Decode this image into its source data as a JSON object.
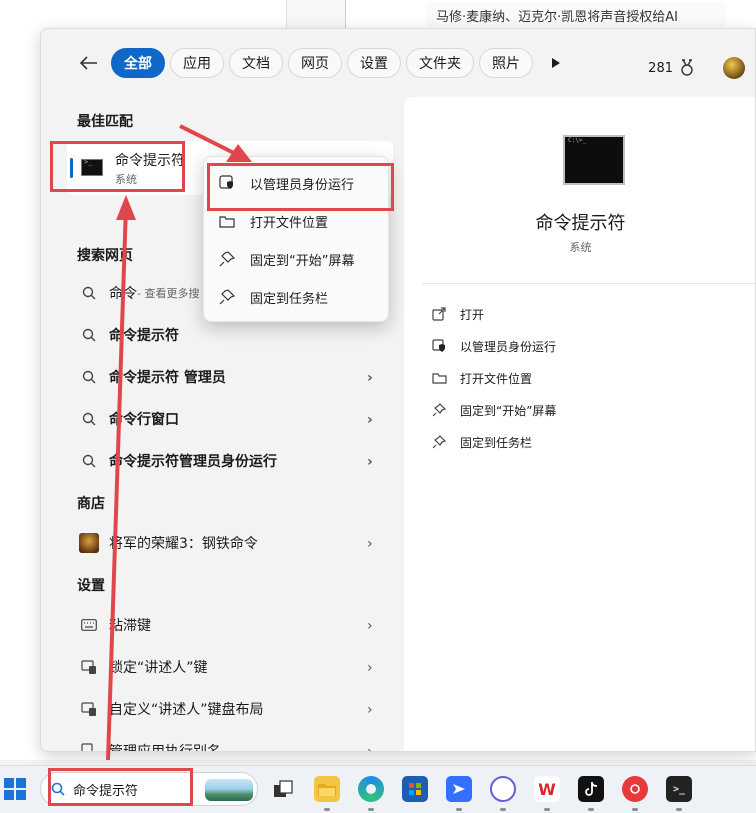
{
  "background": {
    "news_text": "马修·麦康纳、迈克尔·凯恩将声音授权给AI"
  },
  "tabs": {
    "items": [
      "全部",
      "应用",
      "文档",
      "网页",
      "设置",
      "文件夹",
      "照片"
    ],
    "active": "全部",
    "points": "281"
  },
  "left": {
    "best_match_header": "最佳匹配",
    "best_match": {
      "title": "命令提示符",
      "subtitle": "系统"
    },
    "web_header": "搜索网页",
    "web_results": [
      {
        "text": "命令",
        "suffix": " - 查看更多搜"
      },
      {
        "text": "命令提示符"
      },
      {
        "text": "命令提示符 管理员"
      },
      {
        "text": "命令行窗口"
      },
      {
        "text": "命令提示符管理员身份运行"
      }
    ],
    "store_header": "商店",
    "store_item": "将军的荣耀3：钢铁命令",
    "settings_header": "设置",
    "settings_items": [
      "粘滞键",
      "锁定“讲述人”键",
      "自定义“讲述人”键盘布局",
      "管理应用执行别名"
    ]
  },
  "context_menu": {
    "items": [
      "以管理员身份运行",
      "打开文件位置",
      "固定到“开始”屏幕",
      "固定到任务栏"
    ]
  },
  "right": {
    "title": "命令提示符",
    "subtitle": "系统",
    "actions": [
      "打开",
      "以管理员身份运行",
      "打开文件位置",
      "固定到“开始”屏幕",
      "固定到任务栏"
    ]
  },
  "taskbar": {
    "search_value": "命令提示符",
    "apps": [
      "task-view",
      "file-explorer",
      "edge",
      "store",
      "feishu",
      "circle-app",
      "wps",
      "tiktok",
      "netease-music",
      "terminal"
    ]
  },
  "colors": {
    "accent": "#0f67c8",
    "annotation_red": "#e0474c"
  }
}
